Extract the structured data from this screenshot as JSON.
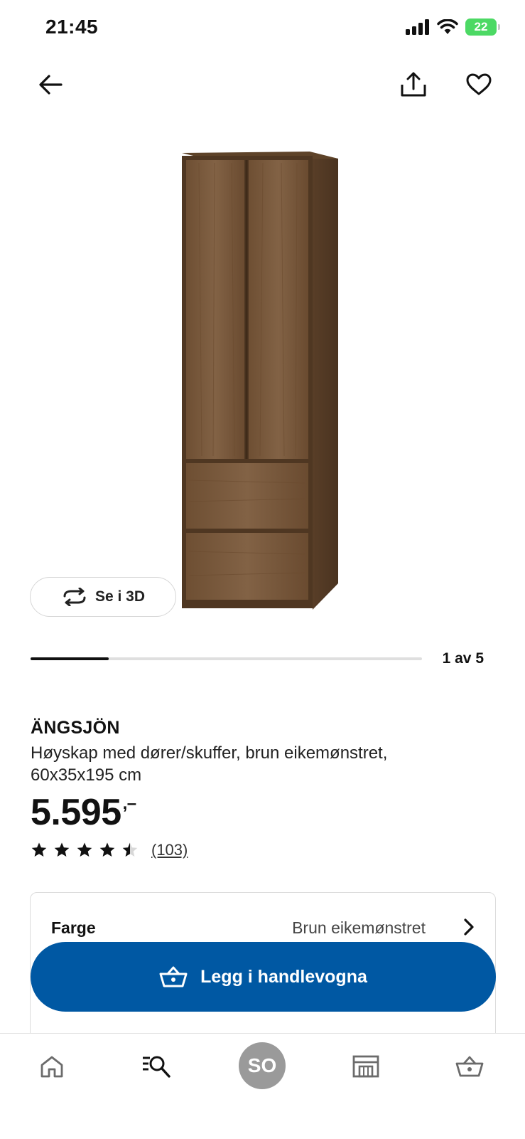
{
  "status_bar": {
    "time": "21:45",
    "battery": "22"
  },
  "top_nav": {
    "back_icon": "arrow-left-icon",
    "share_icon": "share-icon",
    "favorite_icon": "heart-icon"
  },
  "gallery": {
    "view_3d_label": "Se i 3D",
    "position_label": "1 av 5",
    "progress": 0.2
  },
  "product": {
    "name": "ÄNGSJÖN",
    "description": "Høyskap med dører/skuffer, brun eikemønstret, 60x35x195 cm",
    "price": "5.595",
    "price_suffix": ",–",
    "rating": 4.5,
    "review_count": "(103)"
  },
  "color_option": {
    "label": "Farge",
    "value": "Brun eikemønstret"
  },
  "cart": {
    "button_label": "Legg i handlevogna"
  },
  "bottom_nav": {
    "items": [
      "home-icon",
      "search-icon",
      "profile-avatar",
      "store-icon",
      "basket-icon"
    ],
    "avatar_initials": "SO"
  },
  "colors": {
    "accent": "#0058a3",
    "cabinet": "#7a5a3c"
  }
}
